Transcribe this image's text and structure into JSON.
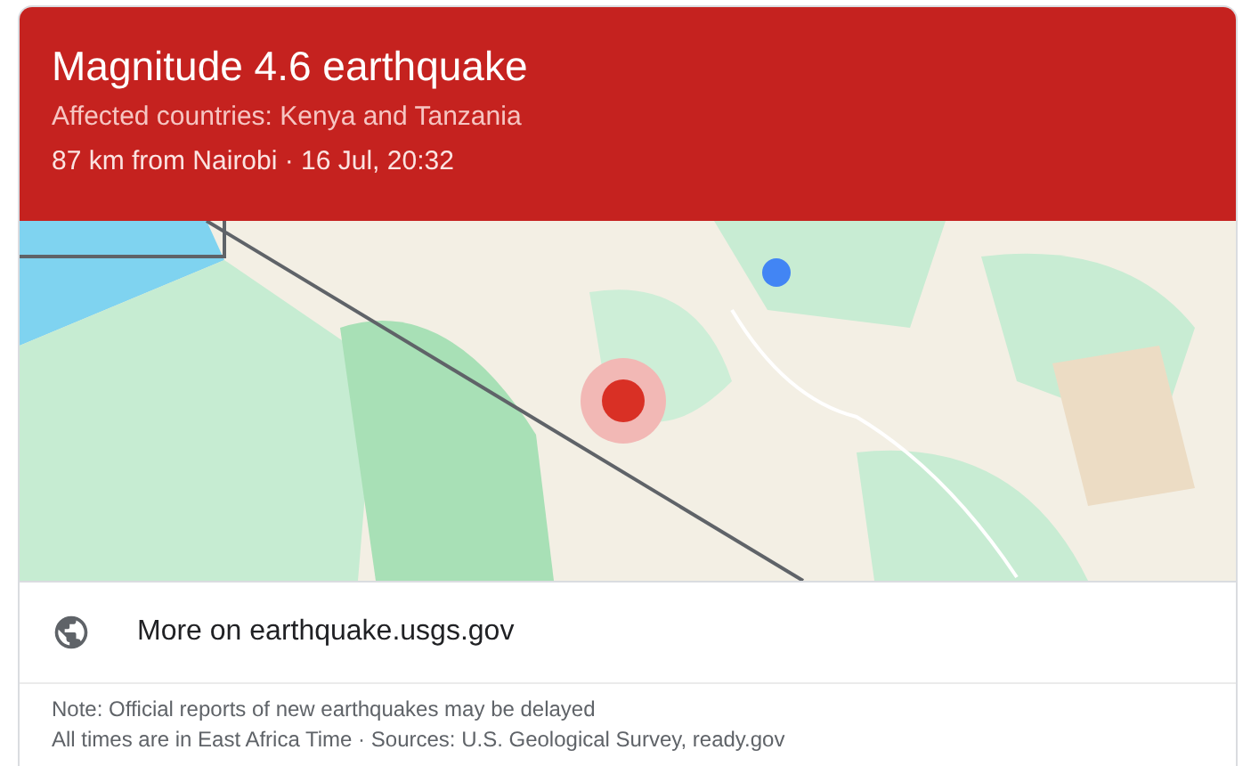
{
  "header": {
    "title": "Magnitude 4.6 earthquake",
    "affected": "Affected countries: Kenya and Tanzania",
    "detail": "87 km from Nairobi · 16 Jul, 20:32"
  },
  "link": {
    "label": "More on earthquake.usgs.gov"
  },
  "notes": [
    "Note: Official reports of new earthquakes may be delayed",
    "All times are in East Africa Time · Sources: U.S. Geological Survey, ready.gov"
  ]
}
